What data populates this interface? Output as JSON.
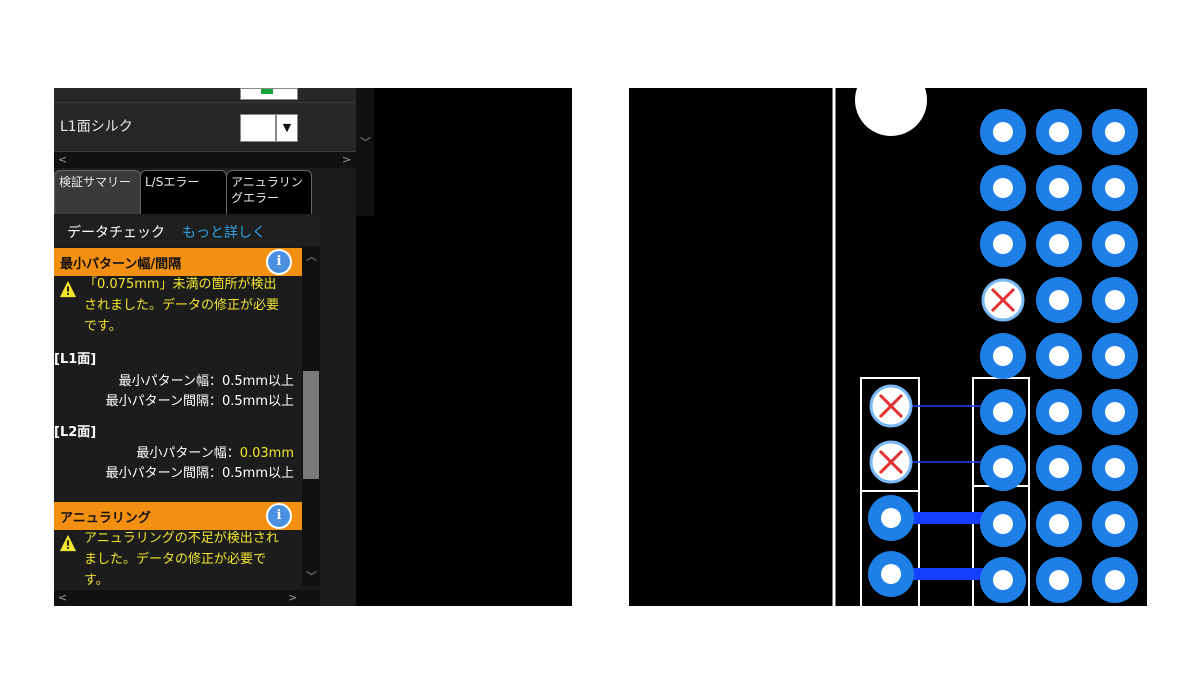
{
  "layers": {
    "silk_label": "L1面シルク"
  },
  "tabs": [
    {
      "label": "検証サマリー"
    },
    {
      "label": "L/Sエラー"
    },
    {
      "label": "アニュラリン\nグエラー"
    }
  ],
  "datacheck": {
    "label": "データチェック",
    "more_link": "もっと詳しく"
  },
  "min_pattern": {
    "title": "最小パターン幅/間隔",
    "warning_lines": [
      "「0.075mm」未満の箇所が検出",
      "されました。データの修正が必要",
      "です。"
    ],
    "l1_heading": "[L1面]",
    "l1_width": "最小パターン幅：0.5mm以上",
    "l1_spacing": "最小パターン間隔：0.5mm以上",
    "l2_heading": "[L2面]",
    "l2_width_label": "最小パターン幅：",
    "l2_width_value": "0.03mm",
    "l2_spacing": "最小パターン間隔：0.5mm以上"
  },
  "annular": {
    "title": "アニュラリング",
    "warning_lines": [
      "アニュラリングの不足が検出され",
      "ました。データの修正が必要で",
      "す。"
    ]
  },
  "info_glyph": "i",
  "icons": [
    "info-icon",
    "warning-icon",
    "chevron-down-icon",
    "chevron-up-icon",
    "chevron-left-icon",
    "chevron-right-icon",
    "error-x-icon"
  ],
  "colors": {
    "section_header": "#f39011",
    "warning_text": "#f2e52d",
    "link": "#2ea5e8",
    "pad_blue": "#1e7fe6",
    "trace_blue": "#1540ff",
    "error_x": "#e03030"
  }
}
